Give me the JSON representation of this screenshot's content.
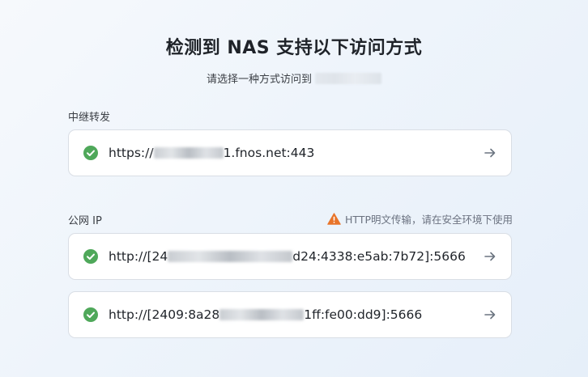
{
  "header": {
    "title": "检测到 NAS 支持以下访问方式",
    "subtitle": "请选择一种方式访问到"
  },
  "relay": {
    "label": "中继转发",
    "url_prefix": "https://",
    "url_suffix": "1.fnos.net:443"
  },
  "public_ip": {
    "label": "公网 IP",
    "warning": "HTTP明文传输，请在安全环境下使用",
    "items": [
      {
        "url_prefix": "http://[24",
        "url_suffix": "d24:4338:e5ab:7b72]:5666"
      },
      {
        "url_prefix": "http://[2409:8a28",
        "url_suffix": "1ff:fe00:dd9]:5666"
      }
    ]
  },
  "colors": {
    "check": "#4fa85a",
    "warning": "#e8742a",
    "arrow": "#6b7480"
  }
}
